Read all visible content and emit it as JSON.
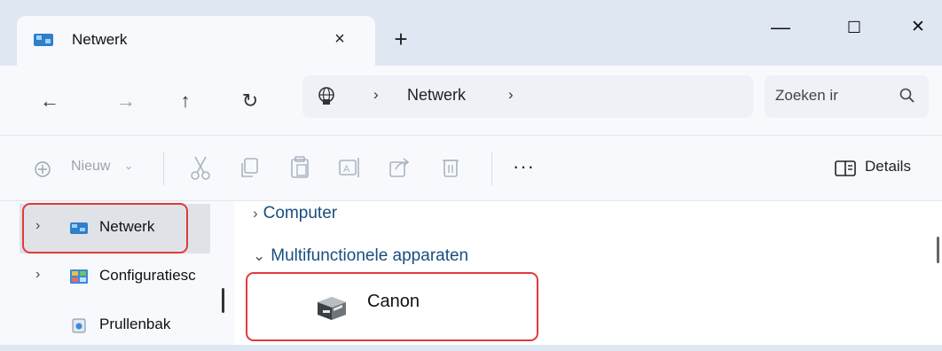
{
  "window": {
    "tab_title": "Netwerk",
    "tab_close": "×",
    "new_tab": "+",
    "minimize": "—",
    "maximize": "☐",
    "close": "✕"
  },
  "nav": {
    "back": "←",
    "forward": "→",
    "up": "↑",
    "refresh": "↻",
    "breadcrumb_sep": "›",
    "breadcrumb": [
      "Netwerk"
    ],
    "search_placeholder": "Zoeken ir"
  },
  "toolbar": {
    "new_label": "Nieuw",
    "more": "···",
    "details_label": "Details"
  },
  "sidebar": {
    "items": [
      {
        "label": "Netwerk",
        "selected": true
      },
      {
        "label": "Configuratiesc",
        "selected": false
      },
      {
        "label": "Prullenbak",
        "selected": false
      }
    ]
  },
  "content": {
    "groups": [
      {
        "name": "Computer",
        "expanded": false
      },
      {
        "name": "Multifunctionele apparaten",
        "expanded": true
      }
    ],
    "items": [
      {
        "label": "Canon",
        "icon": "printer-icon"
      }
    ]
  },
  "colors": {
    "highlight_border": "#e33a3a",
    "group_header": "#1a4e7e",
    "chrome_bg": "#dfe7f3"
  }
}
